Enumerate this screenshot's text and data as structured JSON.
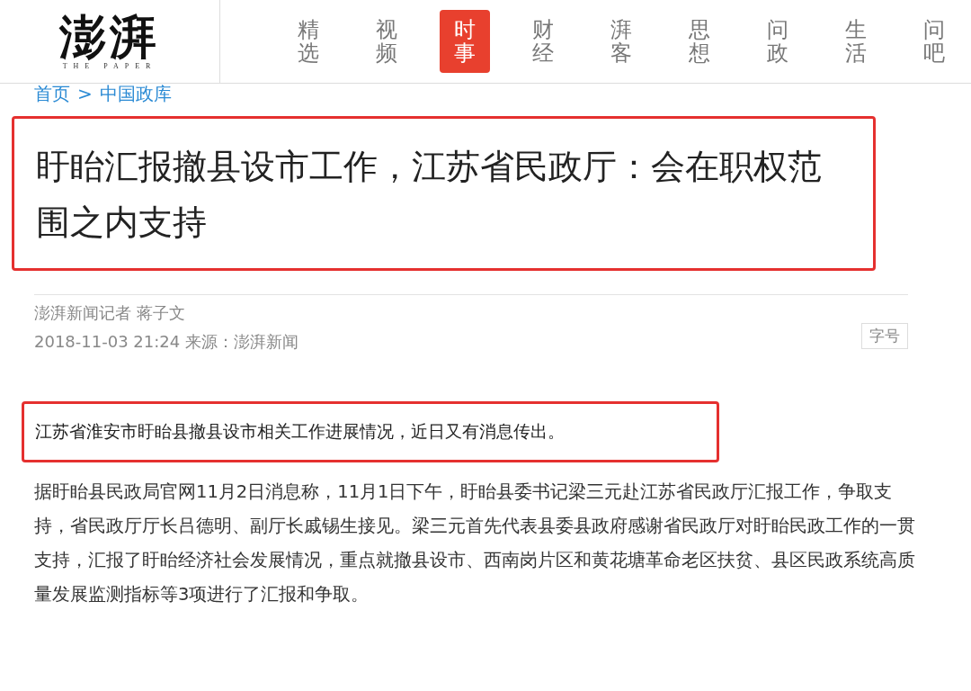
{
  "logo": {
    "name": "澎湃",
    "tagline": "THE PAPER"
  },
  "nav": [
    {
      "label": "精选",
      "selected": false
    },
    {
      "label": "视频",
      "selected": false
    },
    {
      "label": "时事",
      "selected": true
    },
    {
      "label": "财经",
      "selected": false
    },
    {
      "label": "湃客",
      "selected": false
    },
    {
      "label": "思想",
      "selected": false
    },
    {
      "label": "问政",
      "selected": false
    },
    {
      "label": "生活",
      "selected": false
    },
    {
      "label": "问吧",
      "selected": false
    }
  ],
  "breadcrumb": [
    {
      "label": "首页"
    },
    {
      "label": ">"
    },
    {
      "label": "中国政库"
    }
  ],
  "article": {
    "title": "盱眙汇报撤县设市工作，江苏省民政厅：会在职权范围之内支持",
    "title_highlighted": true,
    "author": "澎湃新闻记者 蒋子文",
    "date_source": "2018-11-03 21:24 来源：澎湃新闻",
    "font_size_button": "字号",
    "paragraphs": [
      {
        "text": "江苏省淮安市盱眙县撤县设市相关工作进展情况，近日又有消息传出。",
        "highlighted": true
      },
      {
        "text": "据盱眙县民政局官网11月2日消息称，11月1日下午，盱眙县委书记梁三元赴江苏省民政厅汇报工作，争取支持，省民政厅厅长吕德明、副厅长戚锡生接见。梁三元首先代表县委县政府感谢省民政厅对盱眙民政工作的一贯支持，汇报了盱眙经济社会发展情况，重点就撤县设市、西南岗片区和黄花塘革命老区扶贫、县区民政系统高质量发展监测指标等3项进行了汇报和争取。",
        "highlighted": false
      }
    ]
  }
}
